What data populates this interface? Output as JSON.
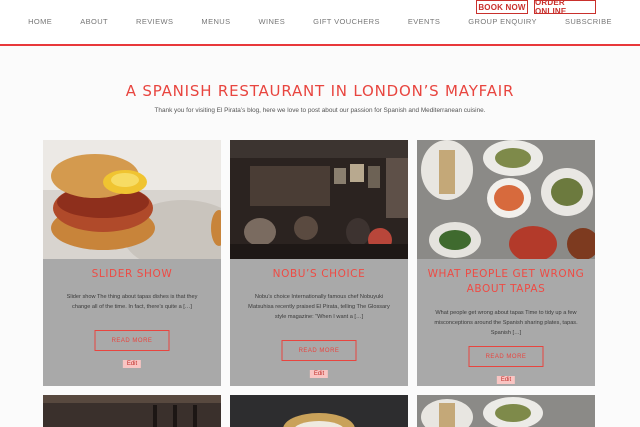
{
  "header": {
    "book_now": "BOOK NOW",
    "order_online": "ORDER ONLINE",
    "nav": [
      {
        "label": "HOME"
      },
      {
        "label": "ABOUT"
      },
      {
        "label": "REVIEWS"
      },
      {
        "label": "MENUS"
      },
      {
        "label": "WINES"
      },
      {
        "label": "GIFT VOUCHERS"
      },
      {
        "label": "EVENTS"
      },
      {
        "label": "GROUP ENQUIRY"
      },
      {
        "label": "SUBSCRIBE"
      }
    ]
  },
  "intro": {
    "title": "A SPANISH RESTAURANT IN LONDON’S MAYFAIR",
    "text": "Thank you for visiting El Pirata’s blog, here we love to post about our passion for Spanish and Mediterranean cuisine."
  },
  "posts": [
    {
      "title": "SLIDER SHOW",
      "excerpt": "Slider show The thing about tapas dishes is that they change all of the time. In fact, there’s quite a […]",
      "read_more": "READ MORE",
      "edit": "Edit"
    },
    {
      "title": "NOBU’S CHOICE",
      "excerpt": "Nobu’s choice Internationally famous chef Nobuyuki Matsuhisa recently praised El Pirata, telling The Glossary style magazine: “When I want a […]",
      "read_more": "READ MORE",
      "edit": "Edit"
    },
    {
      "title": "WHAT PEOPLE GET WRONG ABOUT TAPAS",
      "excerpt": "What people get wrong about tapas Time to tidy up a few misconceptions around the Spanish sharing plates, tapas. Spanish […]",
      "read_more": "READ MORE",
      "edit": "Edit"
    }
  ],
  "colors": {
    "accent": "#e8453f",
    "card_bg": "#a9a9a9",
    "edit_bg": "#f9c5c3"
  }
}
